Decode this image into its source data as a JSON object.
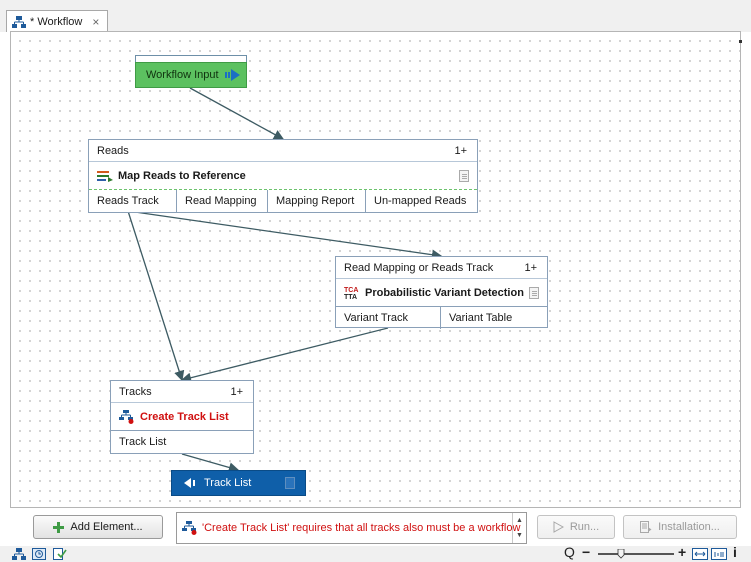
{
  "tab": {
    "title": "* Workflow",
    "close": "×"
  },
  "workflow_input": {
    "label": "Workflow Input"
  },
  "map_reads": {
    "input_label": "Reads",
    "input_count": "1+",
    "name": "Map Reads to Reference",
    "outputs": [
      "Reads Track",
      "Read Mapping",
      "Mapping Report",
      "Un-mapped Reads"
    ]
  },
  "variant": {
    "input_label": "Read Mapping or Reads Track",
    "input_count": "1+",
    "name": "Probabilistic Variant Detection",
    "outputs": [
      "Variant Track",
      "Variant Table"
    ]
  },
  "track_list": {
    "input_label": "Tracks",
    "input_count": "1+",
    "name": "Create Track List",
    "outputs": [
      "Track List"
    ]
  },
  "workflow_output": {
    "label": "Track List"
  },
  "toolbar": {
    "add_element": "Add Element...",
    "message": "'Create Track List' requires that all tracks also must be a workflow",
    "run": "Run...",
    "installation": "Installation..."
  },
  "colors": {
    "input_green": "#5cc160",
    "output_blue": "#0f5fa9",
    "error_red": "#d01010"
  }
}
